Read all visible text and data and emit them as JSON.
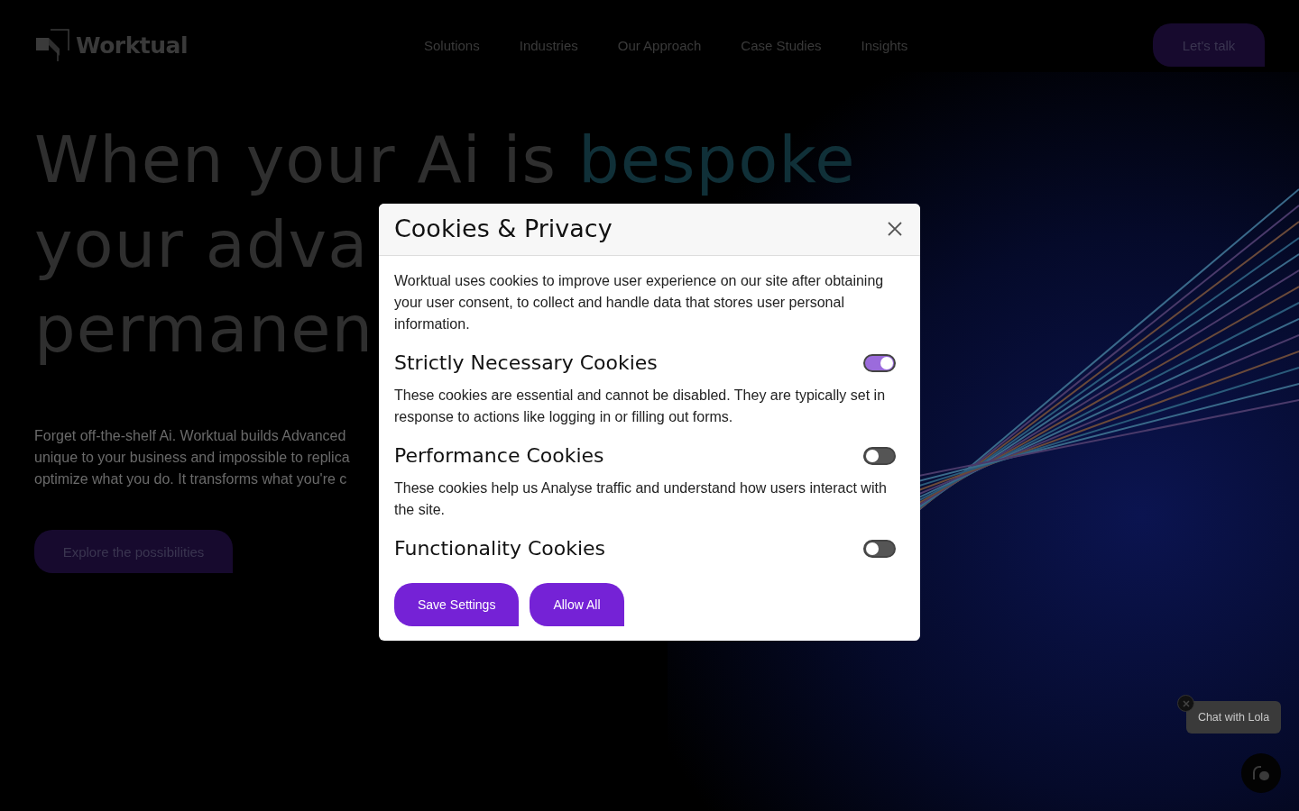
{
  "header": {
    "logo": "Worktual",
    "nav": [
      "Solutions",
      "Industries",
      "Our Approach",
      "Case Studies",
      "Insights"
    ],
    "cta": "Let's talk"
  },
  "hero": {
    "headline": [
      {
        "text": "When your Ai is ",
        "accent": "bespoke"
      },
      {
        "text": "your adva"
      },
      {
        "text": "permanen"
      }
    ],
    "paragraph_lines": [
      "Forget off-the-shelf Ai. Worktual builds Advanced",
      "unique to your business and impossible to replica",
      "optimize what you do. It transforms what you're c"
    ],
    "button": "Explore the possibilities"
  },
  "cookie_dialog": {
    "title": "Cookies & Privacy",
    "intro": "Worktual uses cookies to improve user experience on our site after obtaining your user consent, to collect and handle data that stores user personal information.",
    "sections": [
      {
        "title": "Strictly Necessary Cookies",
        "on": true,
        "description": "These cookies are essential and cannot be disabled. They are typically set in response to actions like logging in or filling out forms."
      },
      {
        "title": "Performance Cookies",
        "on": false,
        "description": "These cookies help us Analyse traffic and understand how users interact with the site."
      },
      {
        "title": "Functionality Cookies",
        "on": false
      }
    ],
    "buttons": [
      "Save Settings",
      "Allow All"
    ]
  },
  "chat_widget": {
    "tooltip": "Chat with Lola"
  }
}
